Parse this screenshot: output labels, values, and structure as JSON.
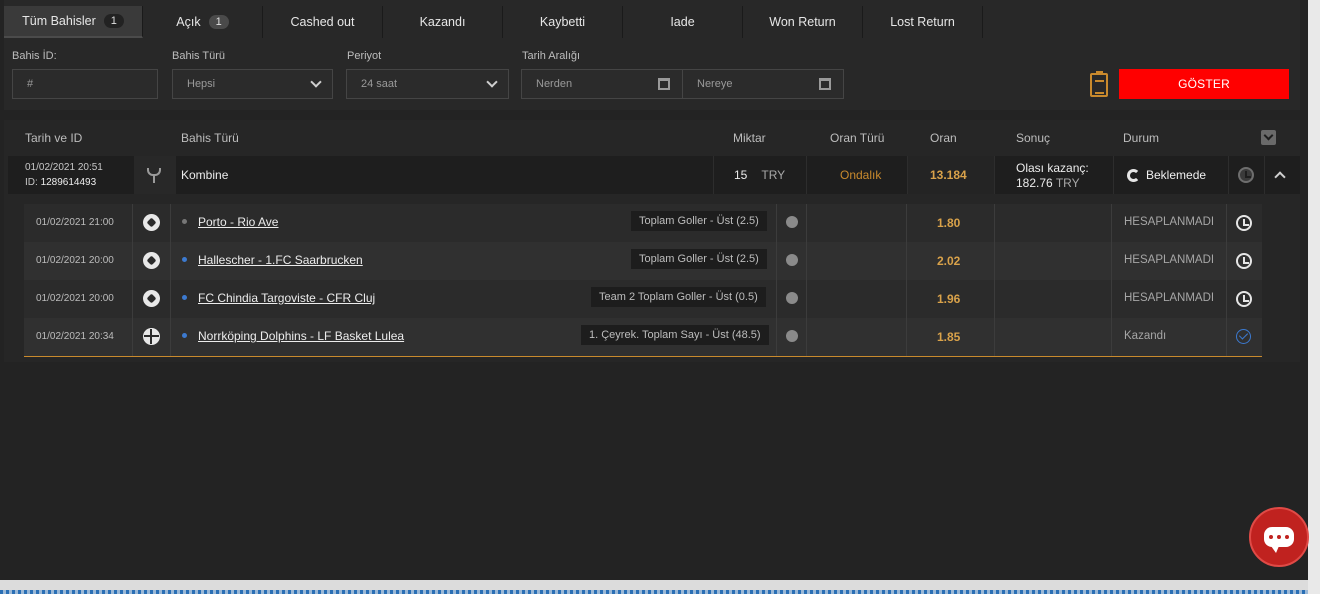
{
  "tabs": [
    {
      "label": "Tüm Bahisler",
      "count": "1"
    },
    {
      "label": "Açık",
      "count": "1"
    },
    {
      "label": "Cashed out"
    },
    {
      "label": "Kazandı"
    },
    {
      "label": "Kaybetti"
    },
    {
      "label": "Iade"
    },
    {
      "label": "Won Return"
    },
    {
      "label": "Lost Return"
    }
  ],
  "filters": {
    "bet_id_label": "Bahis İD:",
    "bet_id_placeholder": "#",
    "bet_type_label": "Bahis Türü",
    "bet_type_value": "Hepsi",
    "period_label": "Periyot",
    "period_value": "24 saat",
    "date_range_label": "Tarih Aralığı",
    "from_placeholder": "Nerden",
    "to_placeholder": "Nereye",
    "show_button": "GÖSTER"
  },
  "table": {
    "headers": {
      "date_id": "Tarih ve ID",
      "bet_type": "Bahis Türü",
      "amount": "Miktar",
      "odds_type": "Oran Türü",
      "odds": "Oran",
      "result": "Sonuç",
      "status": "Durum"
    },
    "bet": {
      "datetime": "01/02/2021 20:51",
      "id_label": "ID:",
      "id": "1289614493",
      "type": "Kombine",
      "amount": "15",
      "currency": "TRY",
      "odds_type": "Ondalık",
      "odds": "13.184",
      "possible_win_label": "Olası kazanç:",
      "possible_win": "182.76",
      "possible_win_currency": "TRY",
      "status": "Beklemede"
    },
    "legs": [
      {
        "datetime": "01/02/2021 21:00",
        "sport_icon": "soccer-ball-icon",
        "match": "Porto - Rio Ave",
        "market": "Toplam Goller - Üst (2.5)",
        "odds": "1.80",
        "status": "HESAPLANMADI",
        "status_icon": "clock-icon"
      },
      {
        "datetime": "01/02/2021 20:00",
        "sport_icon": "soccer-ball-icon",
        "match": "Hallescher - 1.FC Saarbrucken",
        "market": "Toplam Goller - Üst (2.5)",
        "odds": "2.02",
        "status": "HESAPLANMADI",
        "status_icon": "clock-icon"
      },
      {
        "datetime": "01/02/2021 20:00",
        "sport_icon": "soccer-ball-icon",
        "match": "FC Chindia Targoviste - CFR Cluj",
        "market": "Team 2 Toplam Goller - Üst (0.5)",
        "odds": "1.96",
        "status": "HESAPLANMADI",
        "status_icon": "clock-icon"
      },
      {
        "datetime": "01/02/2021 20:34",
        "sport_icon": "basketball-icon",
        "match": "Norrköping Dolphins - LF Basket Lulea",
        "market": "1. Çeyrek. Toplam Sayı - Üst (48.5)",
        "odds": "1.85",
        "status": "Kazandı",
        "status_icon": "check-circle-icon"
      }
    ]
  },
  "colors": {
    "accent_orange": "#d9a24a",
    "show_button": "#ff0000",
    "chat_button": "#c0221f",
    "won_blue": "#3c7ad0"
  }
}
